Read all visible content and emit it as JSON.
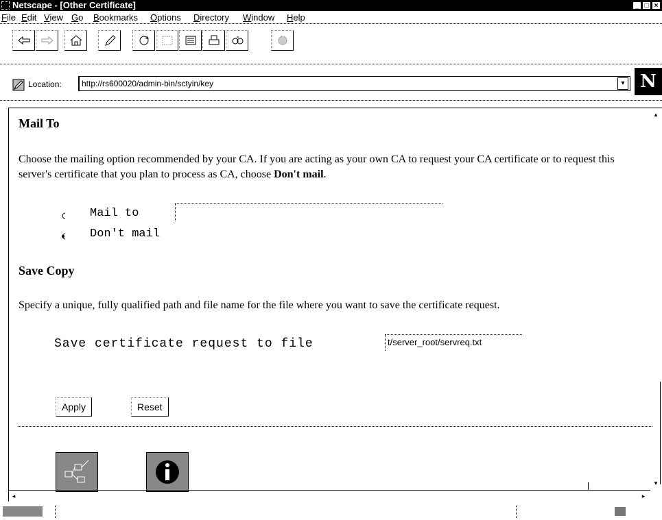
{
  "window": {
    "title": "Netscape - [Other Certificate]",
    "controls": [
      "_",
      "□",
      "×"
    ]
  },
  "menu": [
    {
      "key": "F",
      "rest": "ile"
    },
    {
      "key": "E",
      "rest": "dit"
    },
    {
      "key": "V",
      "rest": "iew"
    },
    {
      "key": "G",
      "rest": "o"
    },
    {
      "key": "B",
      "rest": "ookmarks"
    },
    {
      "key": "O",
      "rest": "ptions"
    },
    {
      "key": "D",
      "rest": "irectory"
    },
    {
      "key": "W",
      "rest": "indow"
    },
    {
      "key": "H",
      "rest": "elp"
    }
  ],
  "toolbar": {
    "buttons": [
      "back-icon",
      "forward-icon",
      "home-icon",
      "edit-icon",
      "reload-icon",
      "images-icon",
      "open-icon",
      "print-icon",
      "find-icon",
      "stop-icon"
    ]
  },
  "location": {
    "label": "Location:",
    "url": "http://rs600020/admin-bin/sctyin/key"
  },
  "logo": "N",
  "mail_section": {
    "heading": "Mail To",
    "description_prefix": "Choose the mailing option recommended by your CA. If you are acting as your own CA to request your CA certificate or to request this server's certificate that you plan to process as CA, choose ",
    "description_bold": "Don't mail",
    "description_suffix": ".",
    "options": [
      {
        "label": "Mail to",
        "selected": false
      },
      {
        "label": "Don't mail",
        "selected": true
      }
    ],
    "mail_to_value": ""
  },
  "save_section": {
    "heading": "Save Copy",
    "description": "Specify a unique, fully qualified path and file name for the file where you want to save the certificate request.",
    "field_label": "Save certificate request to file",
    "field_value": "t/server_root/servreq.txt"
  },
  "buttons": {
    "apply": "Apply",
    "reset": "Reset"
  },
  "bottom_icons": [
    "network-icon",
    "info-icon"
  ]
}
